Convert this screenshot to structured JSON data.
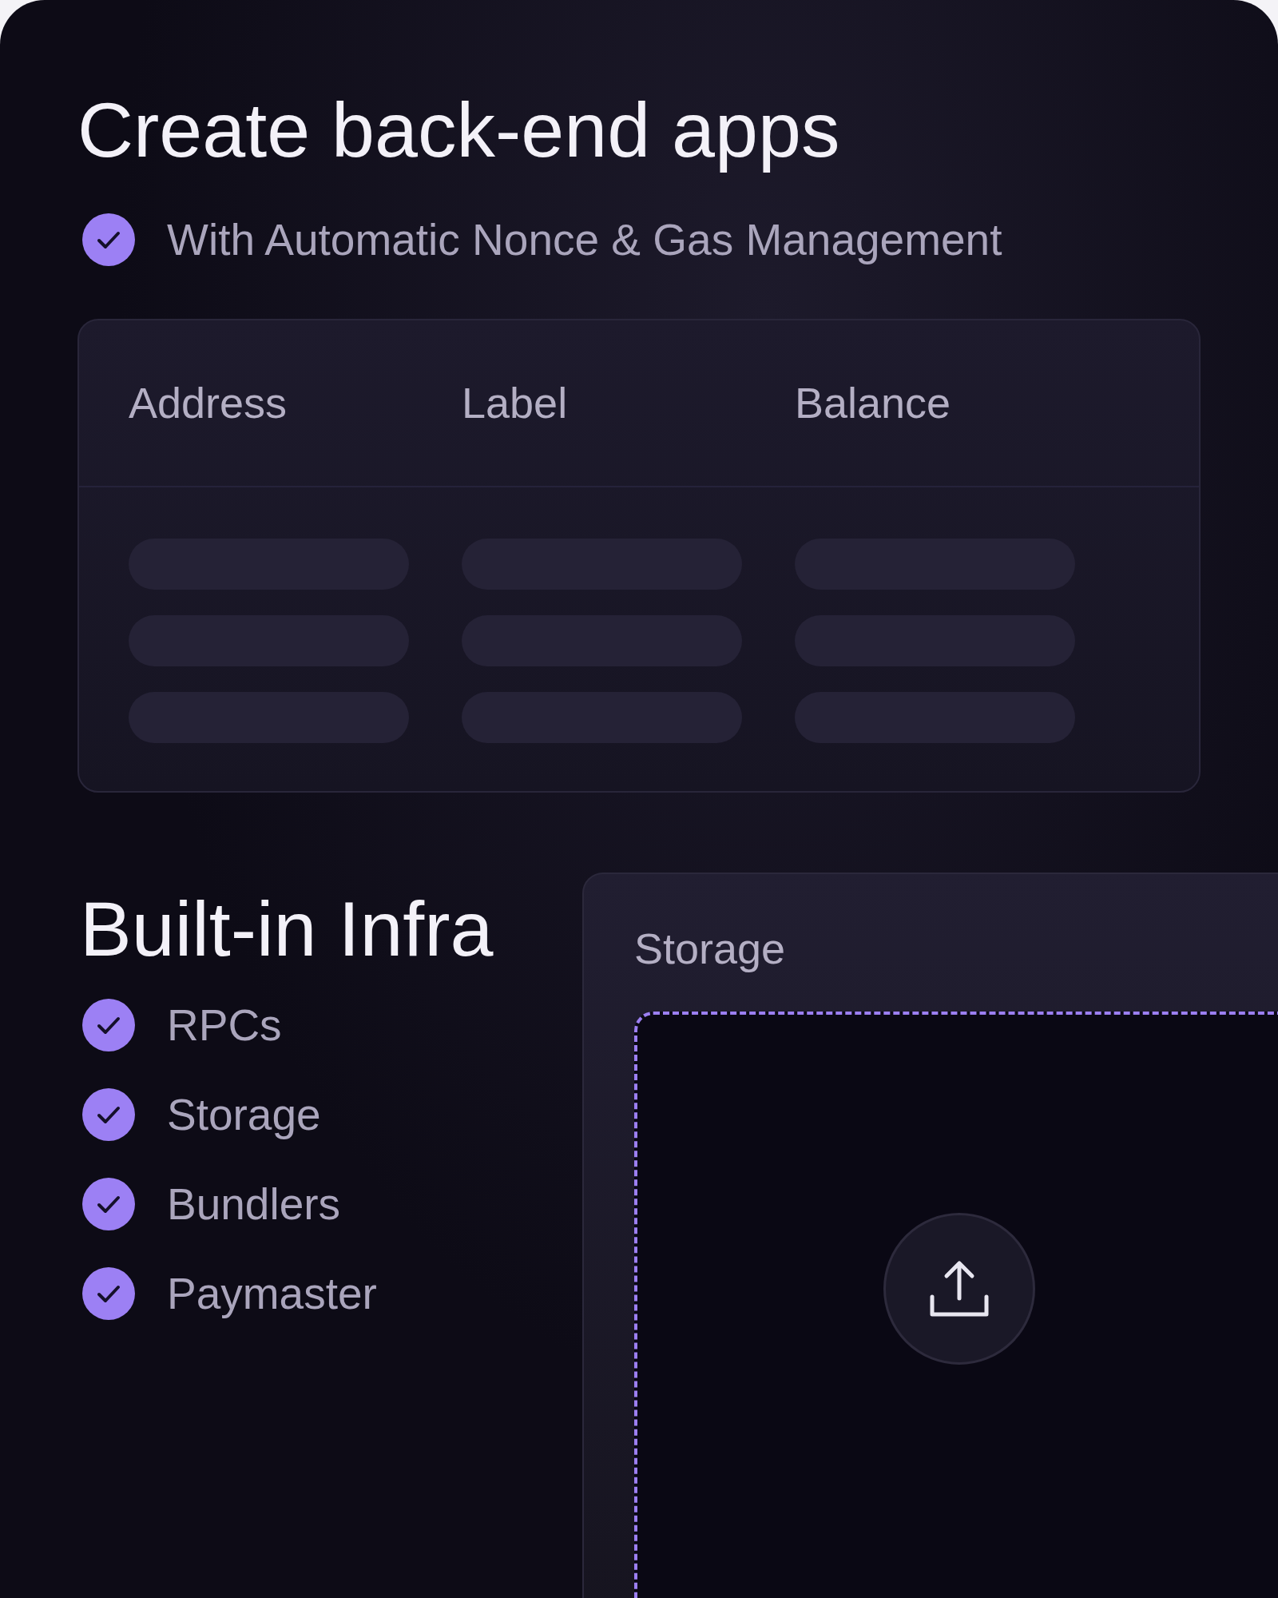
{
  "backend": {
    "title": "Create back-end apps",
    "features": [
      {
        "label": "With Automatic Nonce & Gas Management",
        "checked": true
      }
    ],
    "table": {
      "columns": [
        "Address",
        "Label",
        "Balance"
      ],
      "rows": [
        {
          "loading": true
        },
        {
          "loading": true
        },
        {
          "loading": true
        }
      ]
    }
  },
  "infra": {
    "title": "Built-in Infra",
    "features": [
      {
        "label": "RPCs",
        "checked": true
      },
      {
        "label": "Storage",
        "checked": true
      },
      {
        "label": "Bundlers",
        "checked": true
      },
      {
        "label": "Paymaster",
        "checked": true
      }
    ],
    "storage": {
      "title": "Storage"
    }
  }
}
